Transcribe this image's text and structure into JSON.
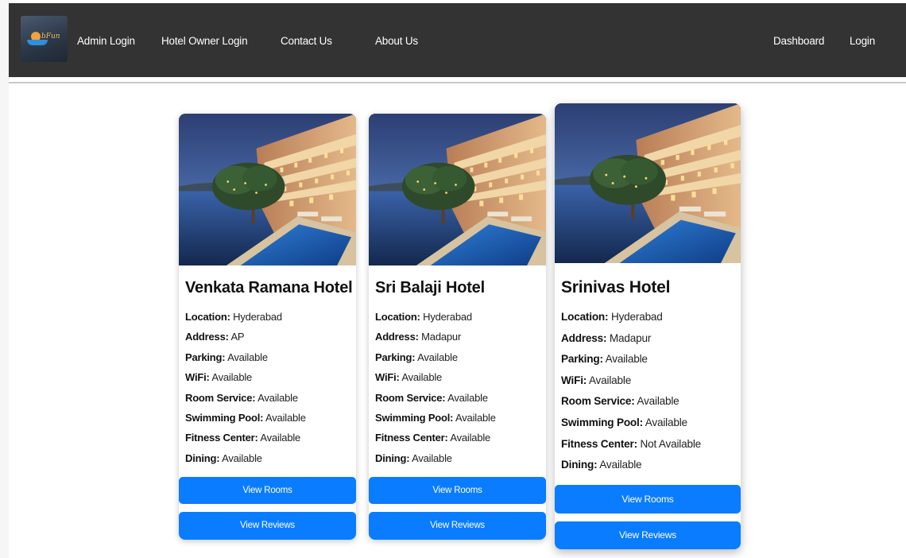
{
  "nav": {
    "logo_text": "bFun",
    "links": [
      "Admin Login",
      "Hotel Owner Login",
      "Contact Us",
      "About Us"
    ],
    "right_links": [
      "Dashboard",
      "Login"
    ]
  },
  "hotels": [
    {
      "name": "Venkata Ramana Hotel",
      "location": "Hyderabad",
      "address": "AP",
      "parking": "Available",
      "wifi": "Available",
      "room_service": "Available",
      "swimming_pool": "Available",
      "fitness_center": "Available",
      "dining": "Available"
    },
    {
      "name": "Sri Balaji Hotel",
      "location": "Hyderabad",
      "address": "Madapur",
      "parking": "Available",
      "wifi": "Available",
      "room_service": "Available",
      "swimming_pool": "Available",
      "fitness_center": "Available",
      "dining": "Available"
    },
    {
      "name": "Srinivas Hotel",
      "location": "Hyderabad",
      "address": "Madapur",
      "parking": "Available",
      "wifi": "Available",
      "room_service": "Available",
      "swimming_pool": "Available",
      "fitness_center": "Not Available",
      "dining": "Available"
    }
  ],
  "labels": {
    "location": "Location:",
    "address": "Address:",
    "parking": "Parking:",
    "wifi": "WiFi:",
    "room_service": "Room Service:",
    "swimming_pool": "Swimming Pool:",
    "fitness_center": "Fitness Center:",
    "dining": "Dining:"
  },
  "buttons": {
    "view_rooms": "View Rooms",
    "view_reviews": "View Reviews"
  },
  "colors": {
    "navbar": "#333333",
    "button": "#0a7cff"
  }
}
